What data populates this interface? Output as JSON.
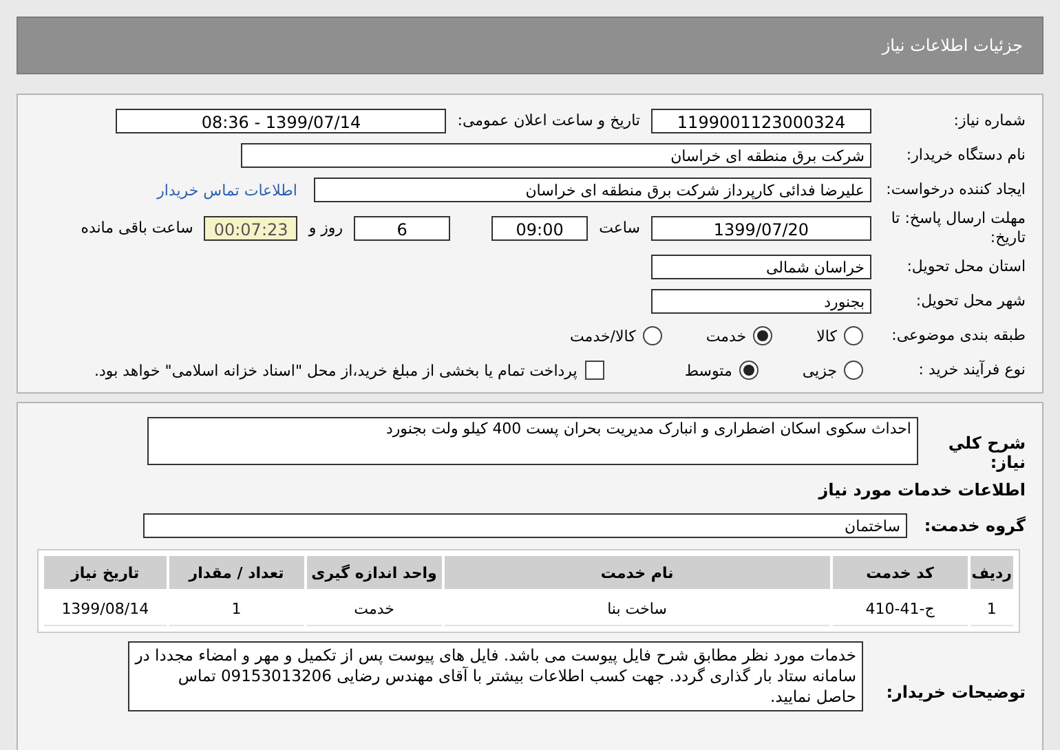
{
  "header": {
    "title": "جزئیات اطلاعات نیاز"
  },
  "details": {
    "need_number": {
      "label": "شماره نیاز:",
      "value": "1199001123000324"
    },
    "announce": {
      "label": "تاریخ و ساعت اعلان عمومی:",
      "value": "1399/07/14 - 08:36"
    },
    "buyer_org": {
      "label": "نام دستگاه خریدار:",
      "value": "شرکت برق منطقه ای خراسان"
    },
    "creator": {
      "label": "ایجاد کننده درخواست:",
      "value": "علیرضا فدائی  کارپرداز شرکت برق منطقه ای خراسان",
      "link": "اطلاعات تماس خریدار"
    },
    "deadline": {
      "label": "مهلت ارسال پاسخ: تا تاریخ:",
      "date": "1399/07/20",
      "time_label": "ساعت",
      "time": "09:00",
      "days": "6",
      "days_label": "روز و",
      "remaining": "00:07:23",
      "remaining_label": "ساعت باقی مانده"
    },
    "province": {
      "label": "استان محل تحویل:",
      "value": "خراسان شمالی"
    },
    "city": {
      "label": "شهر محل تحویل:",
      "value": "بجنورد"
    },
    "category": {
      "label": "طبقه بندی موضوعی:",
      "options": [
        {
          "label": "کالا",
          "selected": false
        },
        {
          "label": "خدمت",
          "selected": true
        },
        {
          "label": "کالا/خدمت",
          "selected": false
        }
      ]
    },
    "process": {
      "label": "نوع فرآیند خرید :",
      "options": [
        {
          "label": "جزیی",
          "selected": false
        },
        {
          "label": "متوسط",
          "selected": true
        }
      ],
      "payment": {
        "label": "پرداخت تمام یا بخشی از مبلغ خرید،از محل \"اسناد خزانه اسلامی\" خواهد بود.",
        "checked": false
      }
    }
  },
  "services": {
    "summary": {
      "label": "شرح کلي نياز:",
      "value": "احداث سکوی اسکان اضطراری و انبارک مدیریت بحران پست 400 کیلو ولت بجنورد"
    },
    "section_title": "اطلاعات خدمات مورد نیاز",
    "group": {
      "label": "گروه خدمت:",
      "value": "ساختمان"
    },
    "table": {
      "columns": [
        "ردیف",
        "کد خدمت",
        "نام خدمت",
        "واحد اندازه گیری",
        "تعداد / مقدار",
        "تاریخ نیاز"
      ],
      "rows": [
        [
          "1",
          "ج-41-410",
          "ساخت بنا",
          "خدمت",
          "1",
          "1399/08/14"
        ]
      ]
    },
    "notes": {
      "label": "توضیحات خریدار:",
      "value": "خدمات مورد نظر مطابق شرح فایل پیوست می باشد. فایل های پیوست پس از تکمیل و مهر و امضاء مجددا در سامانه ستاد بار گذاری گردد. جهت کسب اطلاعات بیشتر با آقای مهندس رضایی 09153013206 تماس حاصل نمایید."
    }
  }
}
